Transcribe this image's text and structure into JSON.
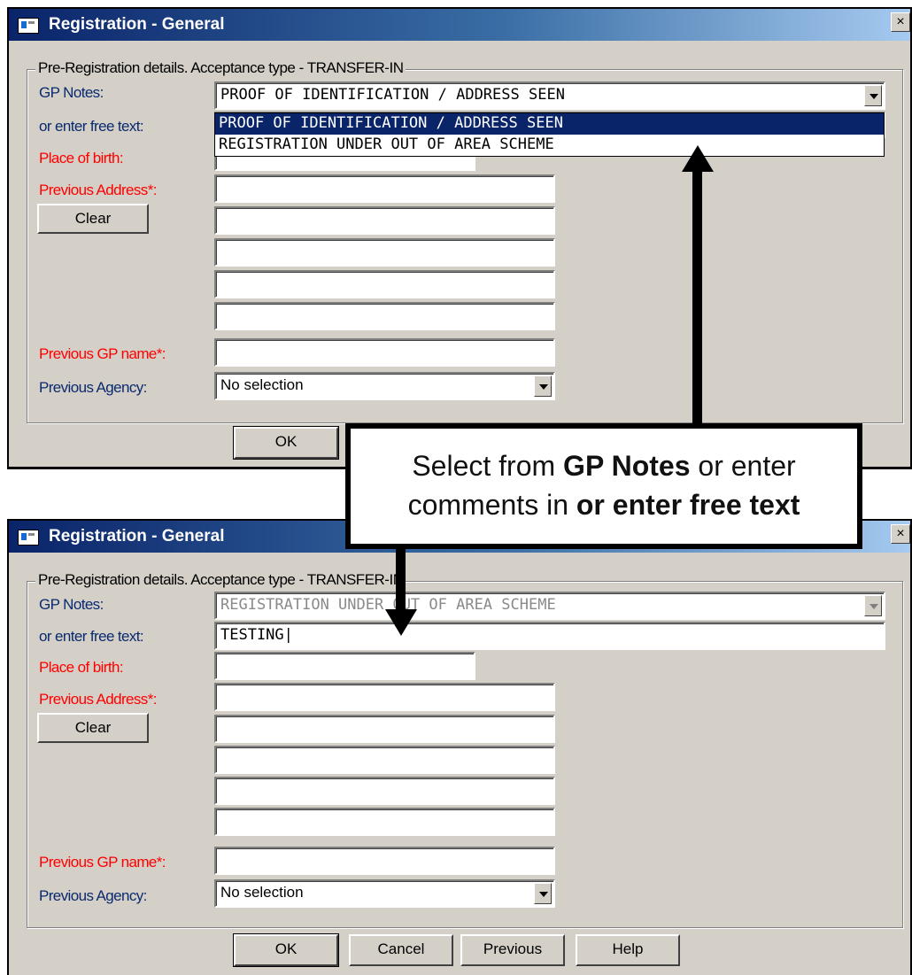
{
  "window_top": {
    "title": "Registration - General",
    "close_glyph": "×",
    "group_legend": "Pre-Registration details. Acceptance type - TRANSFER-IN",
    "labels": {
      "gp_notes": "GP Notes:",
      "free_text": "or enter free text:",
      "place_of_birth": "Place of birth:",
      "previous_address": "Previous Address*:",
      "previous_gp": "Previous GP name*:",
      "previous_agency": "Previous Agency:"
    },
    "gp_notes_value": "PROOF OF IDENTIFICATION / ADDRESS SEEN",
    "dropdown_options": [
      "PROOF OF IDENTIFICATION / ADDRESS SEEN",
      "REGISTRATION UNDER OUT OF AREA SCHEME"
    ],
    "clear_button": "Clear",
    "previous_agency_value": "No selection",
    "ok_button": "OK"
  },
  "window_bottom": {
    "title": "Registration - General",
    "close_glyph": "×",
    "group_legend": "Pre-Registration details. Acceptance type - TRANSFER-IN",
    "labels": {
      "gp_notes": "GP Notes:",
      "free_text": "or enter free text:",
      "place_of_birth": "Place of birth:",
      "previous_address": "Previous Address*:",
      "previous_gp": "Previous GP name*:",
      "previous_agency": "Previous Agency:"
    },
    "gp_notes_value": "REGISTRATION UNDER OUT OF AREA SCHEME",
    "free_text_value": "TESTING|",
    "clear_button": "Clear",
    "previous_agency_value": "No selection",
    "buttons": {
      "ok": "OK",
      "cancel": "Cancel",
      "previous": "Previous",
      "help": "Help"
    }
  },
  "callout": {
    "line1_prefix": "Select from ",
    "line1_bold": "GP Notes",
    "line1_suffix": " or enter",
    "line2_prefix": "comments in ",
    "line2_bold": "or enter free text"
  },
  "colors": {
    "required_label": "#ff0000",
    "selected_item": "#0a246a",
    "window_bg": "#d4d0c8"
  }
}
